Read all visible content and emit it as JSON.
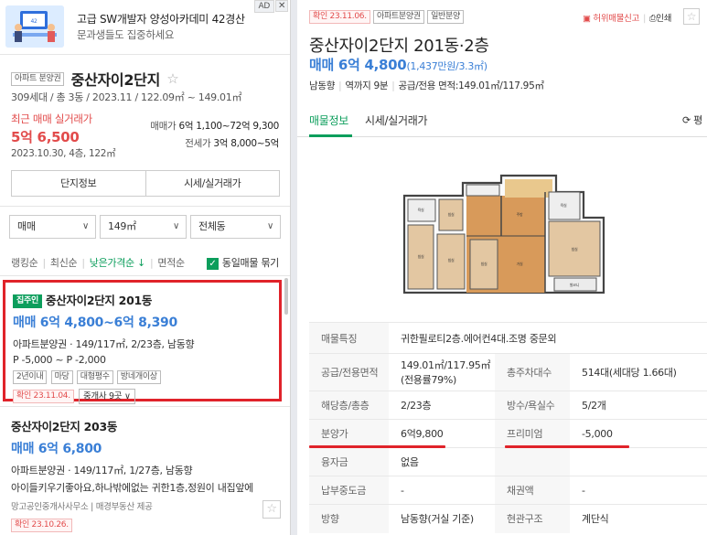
{
  "ad": {
    "title": "고급 SW개발자 양성아카데미 42경산",
    "subtitle": "문과생들도 집중하세요",
    "badge": "AD",
    "close": "✕"
  },
  "complex": {
    "tag": "아파트 분양권",
    "name": "중산자이2단지",
    "info": "309세대 / 총 3동 / 2023.11 / 122.09㎡ ~ 149.01㎡",
    "recent_label": "최근 매매 실거래가",
    "recent_price": "5억 6,500",
    "recent_date": "2023.10.30, 4층, 122㎡",
    "sale_range_label": "매매가",
    "sale_range": "6억 1,100~72억 9,300",
    "jeonse_range_label": "전세가",
    "jeonse_range": "3억 8,000~5억",
    "btn_info": "단지정보",
    "btn_price": "시세/실거래가"
  },
  "filters": {
    "type": "매매",
    "area": "149㎡",
    "dong": "전체동"
  },
  "sort": {
    "items": [
      "랭킹순",
      "최신순",
      "낮은가격순 ↓",
      "면적순"
    ],
    "active_index": 2,
    "same_listing": "동일매물 묶기"
  },
  "listing1": {
    "badge": "집주인",
    "title": "중산자이2단지 201동",
    "price": "매매 6억 4,800~6억 8,390",
    "desc": "아파트분양권 · 149/117㎡, 2/23층, 남동향",
    "premium": "P -5,000 ~ P -2,000",
    "tags": [
      "2년이내",
      "마당",
      "대형평수",
      "방네개이상"
    ],
    "confirm": "확인 23.11.04.",
    "brokers": "중개사 9곳"
  },
  "listing2": {
    "title": "중산자이2단지 203동",
    "price": "매매 6억 6,800",
    "desc": "아파트분양권 · 149/117㎡, 1/27층, 남동향",
    "note": "아이들키우기좋아요,하나밖에없는 귀한1층,정원이 내집앞에",
    "agency": "망고공인중개사사무소 | 매경부동산 제공",
    "confirm": "확인 23.10.26."
  },
  "detail": {
    "confirm_tag": "확인 23.11.06.",
    "tag1": "아파트분양권",
    "tag2": "일반분양",
    "report": "허위매물신고",
    "print": "인쇄",
    "title": "중산자이2단지 201동·2층",
    "price": "매매 6억 4,800",
    "price_per": "(1,437만원/3.3㎡)",
    "info": [
      "남동향",
      "역까지 9분",
      "공급/전용 면적:149.01㎡/117.95㎡"
    ],
    "tab_listing": "매물정보",
    "tab_price": "시세/실거래가",
    "refresh": "평",
    "rows": [
      {
        "k": "매물특징",
        "v": "귀한필로티2층.에어컨4대.조명 중문외",
        "k2": "",
        "v2": ""
      },
      {
        "k": "공급/전용면적",
        "v": "149.01㎡/117.95㎡(전용률79%)",
        "k2": "총주차대수",
        "v2": "514대(세대당 1.66대)"
      },
      {
        "k": "해당층/총층",
        "v": "2/23층",
        "k2": "방수/욕실수",
        "v2": "5/2개"
      },
      {
        "k": "분양가",
        "v": "6억9,800",
        "k2": "프리미엄",
        "v2": "-5,000"
      },
      {
        "k": "융자금",
        "v": "없음",
        "k2": "",
        "v2": ""
      },
      {
        "k": "납부중도금",
        "v": "-",
        "k2": "채권액",
        "v2": "-"
      },
      {
        "k": "방향",
        "v": "남동향(거실 기준)",
        "k2": "현관구조",
        "v2": "계단식"
      }
    ]
  }
}
